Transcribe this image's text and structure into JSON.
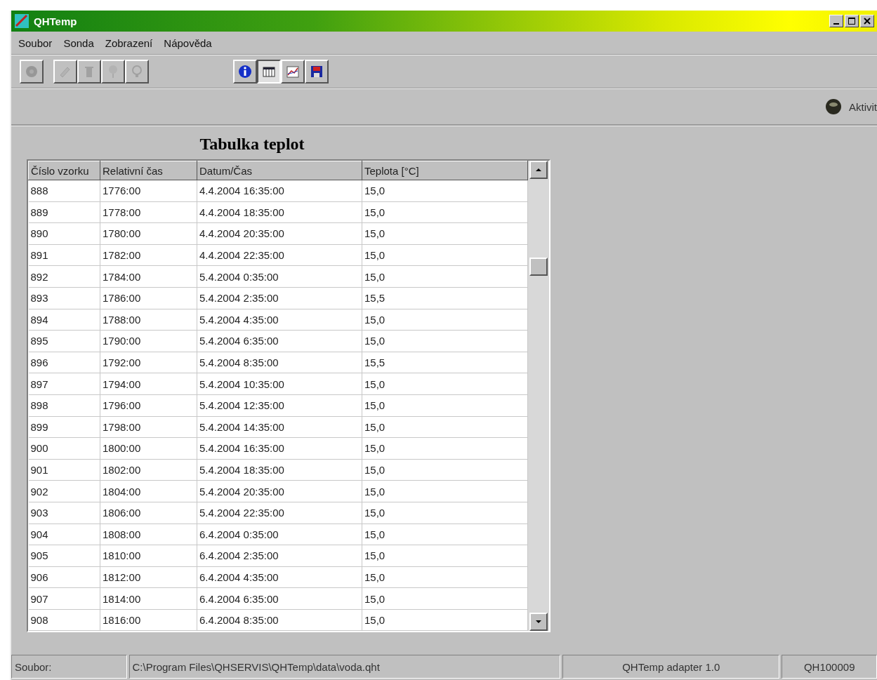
{
  "window": {
    "title": "QHTemp"
  },
  "menu": [
    {
      "label": "Soubor"
    },
    {
      "label": "Sonda"
    },
    {
      "label": "Zobrazení"
    },
    {
      "label": "Nápověda"
    }
  ],
  "toolbar_left": [
    {
      "kind": "disk",
      "disabled": true
    },
    {
      "kind": "pencil",
      "disabled": true
    },
    {
      "kind": "trash",
      "disabled": true
    },
    {
      "kind": "pin",
      "disabled": true
    },
    {
      "kind": "bulb",
      "disabled": true
    }
  ],
  "toolbar_views": [
    {
      "kind": "info",
      "selected": false
    },
    {
      "kind": "table",
      "selected": true
    },
    {
      "kind": "graph",
      "selected": false
    },
    {
      "kind": "save",
      "selected": false
    }
  ],
  "status_indicator": {
    "label": "Aktivit"
  },
  "table": {
    "title": "Tabulka teplot",
    "columns": [
      "Číslo vzorku",
      "Relativní čas",
      "Datum/Čas",
      "Teplota [°C]"
    ],
    "rows": [
      [
        "888",
        "1776:00",
        "4.4.2004 16:35:00",
        "15,0"
      ],
      [
        "889",
        "1778:00",
        "4.4.2004 18:35:00",
        "15,0"
      ],
      [
        "890",
        "1780:00",
        "4.4.2004 20:35:00",
        "15,0"
      ],
      [
        "891",
        "1782:00",
        "4.4.2004 22:35:00",
        "15,0"
      ],
      [
        "892",
        "1784:00",
        "5.4.2004 0:35:00",
        "15,0"
      ],
      [
        "893",
        "1786:00",
        "5.4.2004 2:35:00",
        "15,5"
      ],
      [
        "894",
        "1788:00",
        "5.4.2004 4:35:00",
        "15,0"
      ],
      [
        "895",
        "1790:00",
        "5.4.2004 6:35:00",
        "15,0"
      ],
      [
        "896",
        "1792:00",
        "5.4.2004 8:35:00",
        "15,5"
      ],
      [
        "897",
        "1794:00",
        "5.4.2004 10:35:00",
        "15,0"
      ],
      [
        "898",
        "1796:00",
        "5.4.2004 12:35:00",
        "15,0"
      ],
      [
        "899",
        "1798:00",
        "5.4.2004 14:35:00",
        "15,0"
      ],
      [
        "900",
        "1800:00",
        "5.4.2004 16:35:00",
        "15,0"
      ],
      [
        "901",
        "1802:00",
        "5.4.2004 18:35:00",
        "15,0"
      ],
      [
        "902",
        "1804:00",
        "5.4.2004 20:35:00",
        "15,0"
      ],
      [
        "903",
        "1806:00",
        "5.4.2004 22:35:00",
        "15,0"
      ],
      [
        "904",
        "1808:00",
        "6.4.2004 0:35:00",
        "15,0"
      ],
      [
        "905",
        "1810:00",
        "6.4.2004 2:35:00",
        "15,0"
      ],
      [
        "906",
        "1812:00",
        "6.4.2004 4:35:00",
        "15,0"
      ],
      [
        "907",
        "1814:00",
        "6.4.2004 6:35:00",
        "15,0"
      ],
      [
        "908",
        "1816:00",
        "6.4.2004 8:35:00",
        "15,0"
      ]
    ]
  },
  "status_bar": [
    "Soubor:",
    "C:\\Program Files\\QHSERVIS\\QHTemp\\data\\voda.qht",
    "QHTemp adapter 1.0",
    "QH100009"
  ]
}
